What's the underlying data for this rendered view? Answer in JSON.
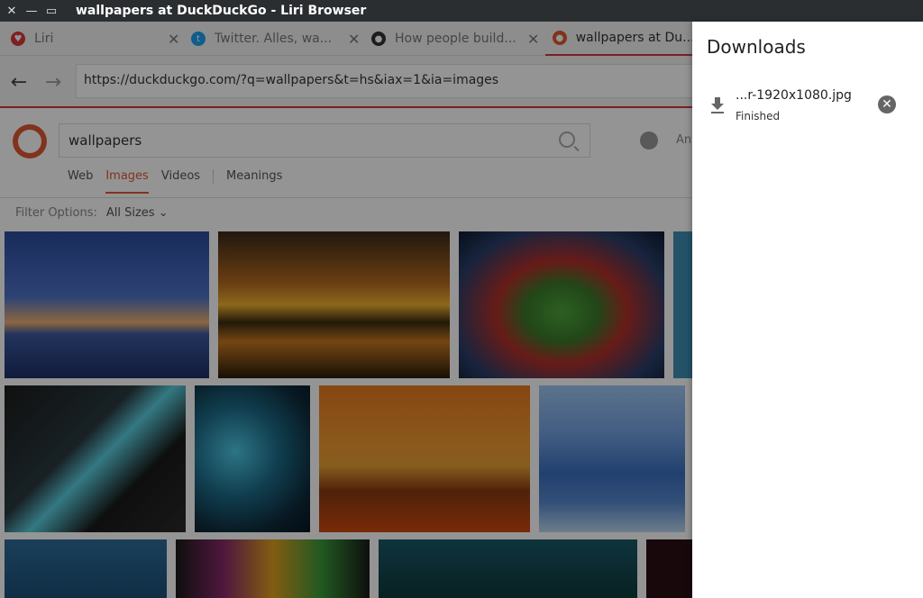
{
  "window": {
    "title": "wallpapers at DuckDuckGo - Liri Browser",
    "close_glyph": "✕",
    "minimize_glyph": "—",
    "maximize_glyph": "▭"
  },
  "tabs": [
    {
      "label": "Liri",
      "icon": "liri-icon",
      "color": "#d8383a"
    },
    {
      "label": "Twitter. Alles, wa...",
      "icon": "twitter-icon",
      "color": "#1da1f2"
    },
    {
      "label": "How people build...",
      "icon": "github-icon",
      "color": "#333333"
    },
    {
      "label": "wallpapers at Du...",
      "icon": "duckduckgo-icon",
      "color": "#de5833"
    }
  ],
  "toolbar": {
    "back_glyph": "←",
    "forward_glyph": "→",
    "url": "https://duckduckgo.com/?q=wallpapers&t=hs&iax=1&ia=images"
  },
  "ddg": {
    "search_value": "wallpapers",
    "region_label": "Any",
    "nav": [
      "Web",
      "Images",
      "Videos",
      "Meanings"
    ],
    "active_nav": "Images",
    "filter_label": "Filter Options:",
    "filter_value": "All Sizes ⌄"
  },
  "downloads": {
    "title": "Downloads",
    "items": [
      {
        "filename": "...r-1920x1080.jpg",
        "status": "Finished"
      }
    ]
  },
  "colors": {
    "accent": "#d8383a",
    "ddg_orange": "#de5833",
    "titlebar": "#2b2e31"
  }
}
